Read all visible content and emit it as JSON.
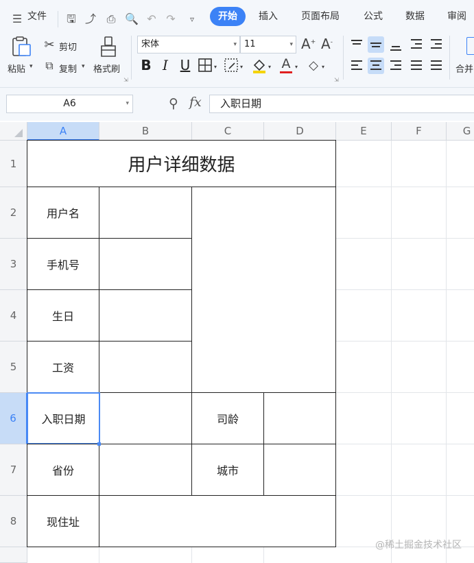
{
  "menu": {
    "file_label": "文件"
  },
  "tabs": [
    "开始",
    "插入",
    "页面布局",
    "公式",
    "数据",
    "审阅"
  ],
  "clipboard": {
    "paste_label": "粘贴",
    "cut_label": "剪切",
    "copy_label": "复制",
    "format_painter_label": "格式刷"
  },
  "font": {
    "name": "宋体",
    "size": "11"
  },
  "format_buttons": {
    "bold": "B",
    "italic": "I",
    "underline": "U"
  },
  "merge": {
    "label": "合并"
  },
  "formula_bar": {
    "cell_ref": "A6",
    "fx_label": "fx",
    "value": "入职日期"
  },
  "columns": [
    "A",
    "B",
    "C",
    "D",
    "E",
    "F",
    "G"
  ],
  "rows": [
    "1",
    "2",
    "3",
    "4",
    "5",
    "6",
    "7",
    "8"
  ],
  "sheet": {
    "title": "用户详细数据",
    "username_label": "用户名",
    "phone_label": "手机号",
    "birthday_label": "生日",
    "salary_label": "工资",
    "hire_date_label": "入职日期",
    "seniority_label": "司龄",
    "province_label": "省份",
    "city_label": "城市",
    "address_label": "现住址"
  },
  "watermark": "@稀土掘金技术社区",
  "colors": {
    "accent": "#3c82f6",
    "selection": "#c7dcf7"
  }
}
